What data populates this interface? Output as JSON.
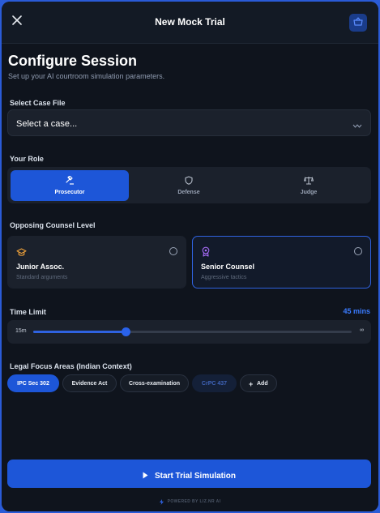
{
  "header": {
    "title": "New Mock Trial",
    "close_icon": "close-icon",
    "action_icon": "basket-icon"
  },
  "page": {
    "title": "Configure Session",
    "subtitle": "Set up your AI courtroom simulation parameters."
  },
  "case_file": {
    "label": "Select Case File",
    "selected": "Select a case...",
    "icon": "chevron-down-icon"
  },
  "role": {
    "label": "Your Role",
    "options": [
      {
        "label": "Prosecutor",
        "icon": "gavel-icon",
        "active": true
      },
      {
        "label": "Defense",
        "icon": "shield-icon",
        "active": false
      },
      {
        "label": "Judge",
        "icon": "scales-icon",
        "active": false
      }
    ]
  },
  "counsel": {
    "label": "Opposing Counsel Level",
    "options": [
      {
        "title": "Junior Assoc.",
        "desc": "Standard arguments",
        "icon": "graduation-cap-icon",
        "icon_color": "#f0a23a",
        "selected": false
      },
      {
        "title": "Senior Counsel",
        "desc": "Aggressive tactics",
        "icon": "award-icon",
        "icon_color": "#a56bf5",
        "selected": true
      }
    ]
  },
  "time_limit": {
    "label": "Time Limit",
    "value_text": "45 mins",
    "min_label": "15m",
    "max_label": "∞",
    "fill_fraction": 0.29
  },
  "focus": {
    "label": "Legal Focus Areas (Indian Context)",
    "chips": [
      {
        "label": "IPC Sec 302",
        "state": "active"
      },
      {
        "label": "Evidence Act",
        "state": "default"
      },
      {
        "label": "Cross-examination",
        "state": "default"
      },
      {
        "label": "CrPC 437",
        "state": "muted"
      }
    ],
    "add_label": "Add",
    "add_icon": "plus-icon"
  },
  "footer": {
    "start_label": "Start Trial Simulation",
    "start_icon": "play-icon",
    "powered_text": "POWERED BY LIZ.NR AI",
    "powered_icon": "bolt-icon"
  },
  "colors": {
    "accent": "#1d56d8",
    "background": "#0f141d",
    "frame": "#2a5bd7"
  }
}
